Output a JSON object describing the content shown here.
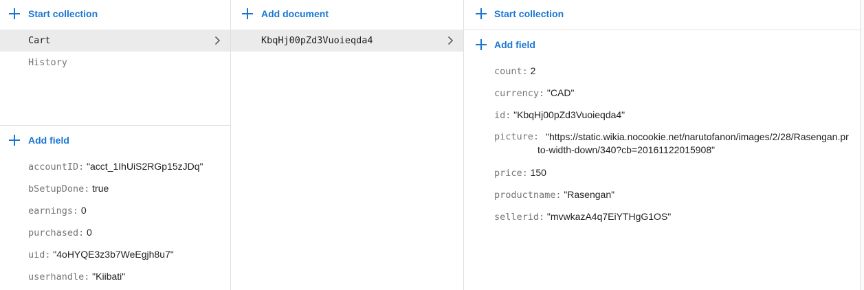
{
  "panel1": {
    "start_collection_label": "Start collection",
    "collections": [
      {
        "label": "Cart",
        "selected": true
      },
      {
        "label": "History",
        "selected": false
      }
    ],
    "add_field_label": "Add field",
    "fields": [
      {
        "key": "accountID:",
        "value": "\"acct_1IhUiS2RGp15zJDq\""
      },
      {
        "key": "bSetupDone:",
        "value": "true"
      },
      {
        "key": "earnings:",
        "value": "0"
      },
      {
        "key": "purchased:",
        "value": "0"
      },
      {
        "key": "uid:",
        "value": "\"4oHYQE3z3b7WeEgjh8u7\""
      },
      {
        "key": "userhandle:",
        "value": "\"Kiibati\""
      }
    ]
  },
  "panel2": {
    "add_document_label": "Add document",
    "documents": [
      {
        "label": "KbqHj00pZd3Vuoieqda4",
        "selected": true
      }
    ]
  },
  "panel3": {
    "start_collection_label": "Start collection",
    "add_field_label": "Add field",
    "fields": [
      {
        "key": "count:",
        "value": "2"
      },
      {
        "key": "currency:",
        "value": "\"CAD\""
      },
      {
        "key": "id:",
        "value": "\"KbqHj00pZd3Vuoieqda4\""
      },
      {
        "key": "picture:",
        "value_line1": "\"https://static.wikia.nocookie.net/narutofanon/images/2/28/Rasengan.pr",
        "value_line2": "to-width-down/340?cb=20161122015908\""
      },
      {
        "key": "price:",
        "value": "150"
      },
      {
        "key": "productname:",
        "value": "\"Rasengan\""
      },
      {
        "key": "sellerid:",
        "value": "\"mvwkazA4q7EiYTHgG1OS\""
      }
    ]
  },
  "icons": {
    "plus": "plus-icon",
    "chevron": "chevron-right-icon"
  },
  "colors": {
    "accent": "#1976d2",
    "selected_bg": "#ebebeb",
    "key_text": "#757575",
    "value_text": "#212121",
    "divider": "#e0e0e0"
  }
}
